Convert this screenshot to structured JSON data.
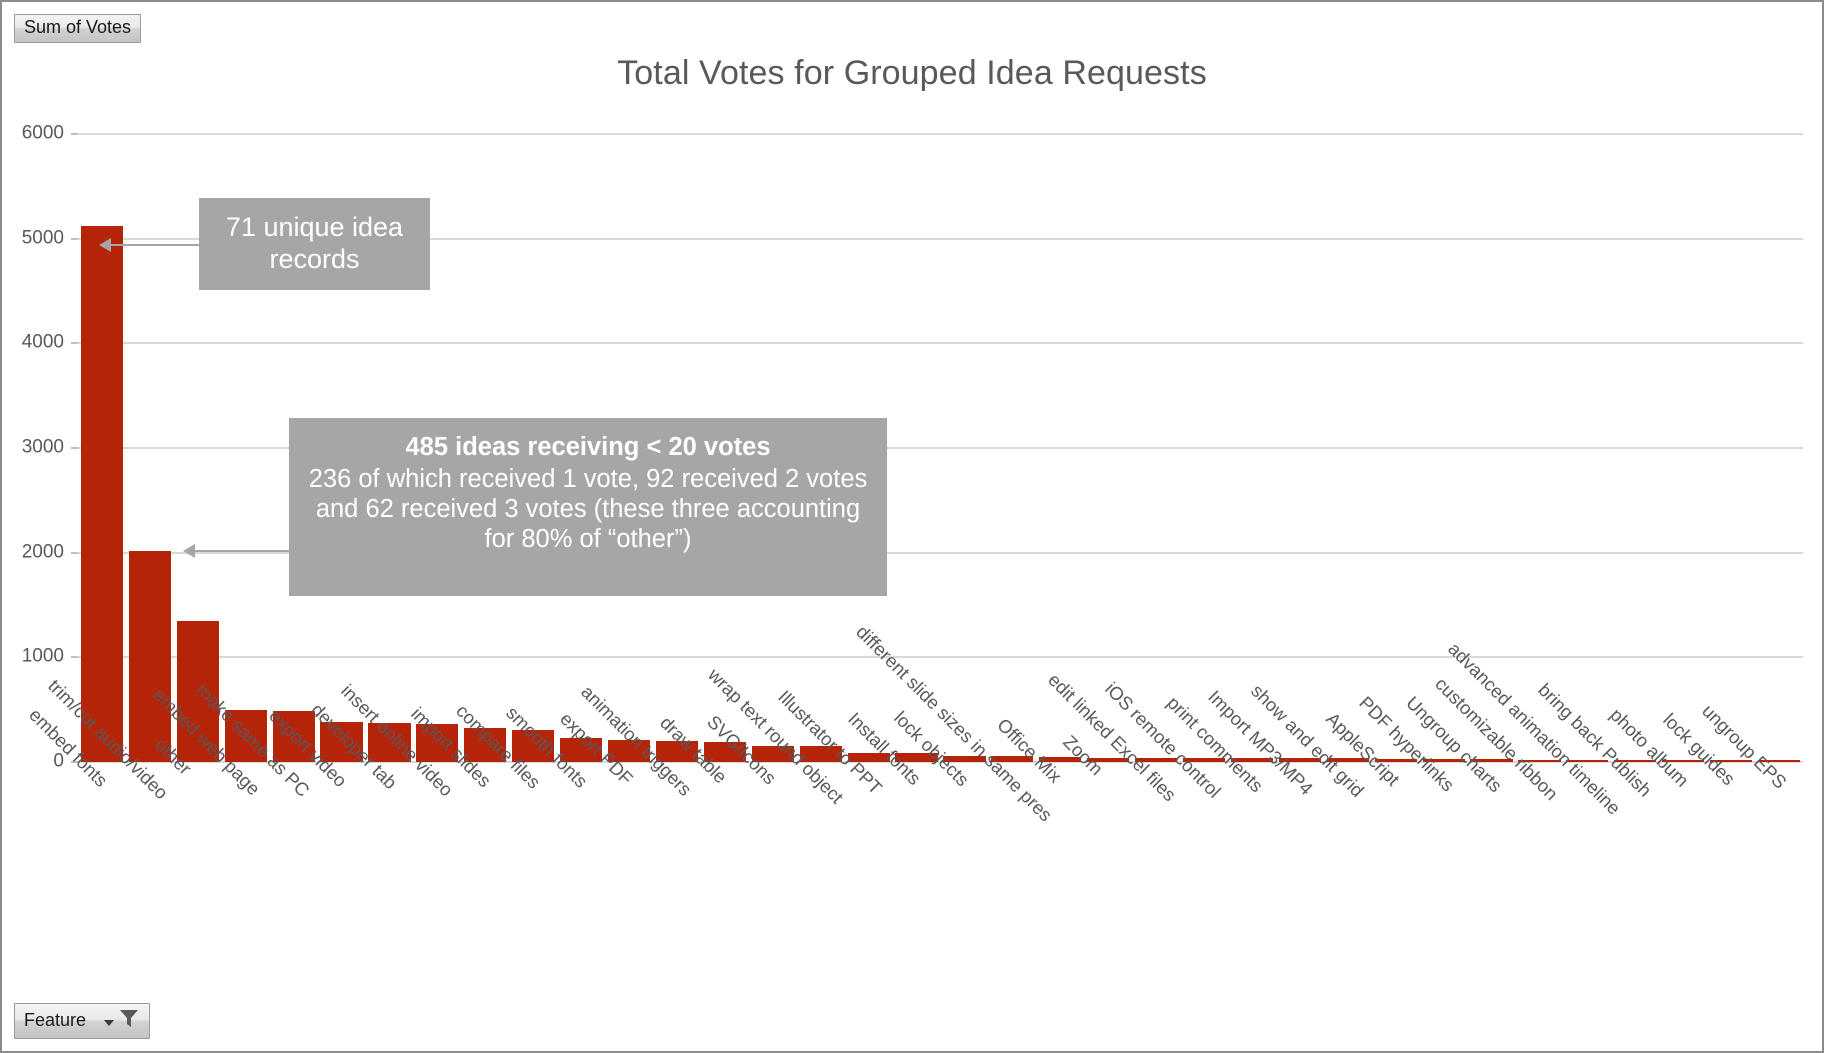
{
  "legend_field_button": {
    "label": "Sum of Votes",
    "icon": "none"
  },
  "axis_field_button": {
    "label": "Feature",
    "dropdown_icon": "chevron-down-icon",
    "filter_icon": "funnel-filter-icon"
  },
  "callouts": {
    "records": {
      "text": "71 unique idea records"
    },
    "low_votes": {
      "headline": "485 ideas receiving < 20 votes",
      "body": "236 of which received 1 vote, 92 received 2 votes and 62 received 3 votes (these three accounting for 80% of “other”)"
    }
  },
  "colors": {
    "bar": "#b52308",
    "title_text": "#595959",
    "gridline": "#d9d9d9",
    "callout_background": "#a6a6a6",
    "callout_text": "#ffffff"
  },
  "chart_data": {
    "type": "bar",
    "title": "Total Votes for Grouped Idea Requests",
    "xlabel": "",
    "ylabel": "",
    "ylim": [
      0,
      6000
    ],
    "yticks": [
      0,
      1000,
      2000,
      3000,
      4000,
      5000,
      6000
    ],
    "ytick_labels": [
      "0",
      "1000",
      "2000",
      "3000",
      "4000",
      "5000",
      "6000"
    ],
    "grid": true,
    "legend_position": "none",
    "series_name": "Sum of Votes",
    "categories": [
      "embed fonts",
      "trim/cut audio/video",
      "other",
      "embed web page",
      "make same as PC",
      "export video",
      "developer tab",
      "insert online video",
      "import slides",
      "compare files",
      "smooth fonts",
      "export PDF",
      "animation triggers",
      "draw table",
      "SVG/Icons",
      "wrap text round object",
      "Illustrator to PPT",
      "Install fonts",
      "lock objects",
      "different slide sizes in same pres",
      "Office Mix",
      "Zoom",
      "edit linked Excel files",
      "iOS remote control",
      "print comments",
      "Import MP3/MP4",
      "show and edit grid",
      "AppleScript",
      "PDF hyperlinks",
      "Ungroup charts",
      "customizable ribbon",
      "advanced animation timeline",
      "bring back Publish",
      "photo album",
      "lock guides",
      "ungroup EPS"
    ],
    "values": [
      5125,
      2020,
      1345,
      500,
      490,
      385,
      375,
      365,
      325,
      305,
      225,
      215,
      205,
      195,
      155,
      150,
      90,
      85,
      55,
      55,
      50,
      40,
      40,
      35,
      35,
      35,
      35,
      30,
      30,
      25,
      20,
      20,
      20,
      20,
      20,
      15
    ]
  }
}
